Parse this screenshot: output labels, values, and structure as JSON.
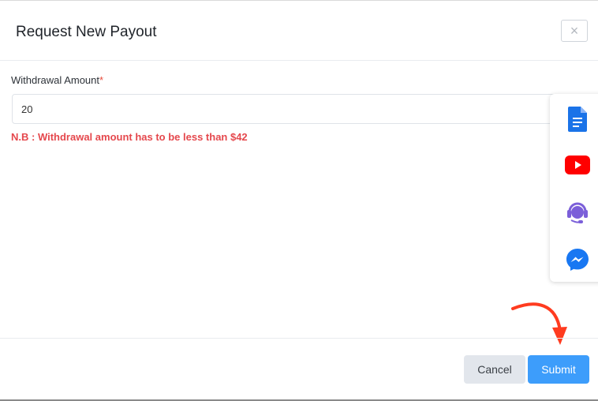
{
  "modal": {
    "title": "Request New Payout",
    "close_icon": "close-icon",
    "close_glyph": "×"
  },
  "form": {
    "amount_label": "Withdrawal Amount",
    "required_mark": "*",
    "amount_value": "20",
    "note": "N.B : Withdrawal amount has to be less than $42"
  },
  "side_panel": {
    "items": [
      {
        "icon": "document-icon",
        "color": "#1a73e8"
      },
      {
        "icon": "youtube-icon",
        "color": "#ff0000"
      },
      {
        "icon": "support-headset-icon",
        "color": "#7b5fd9"
      },
      {
        "icon": "messenger-icon",
        "color": "#1877f2"
      }
    ]
  },
  "footer": {
    "cancel_label": "Cancel",
    "submit_label": "Submit"
  },
  "colors": {
    "accent": "#3d9dfb",
    "error": "#e5484d",
    "annotation_arrow": "#ff3b1f"
  }
}
